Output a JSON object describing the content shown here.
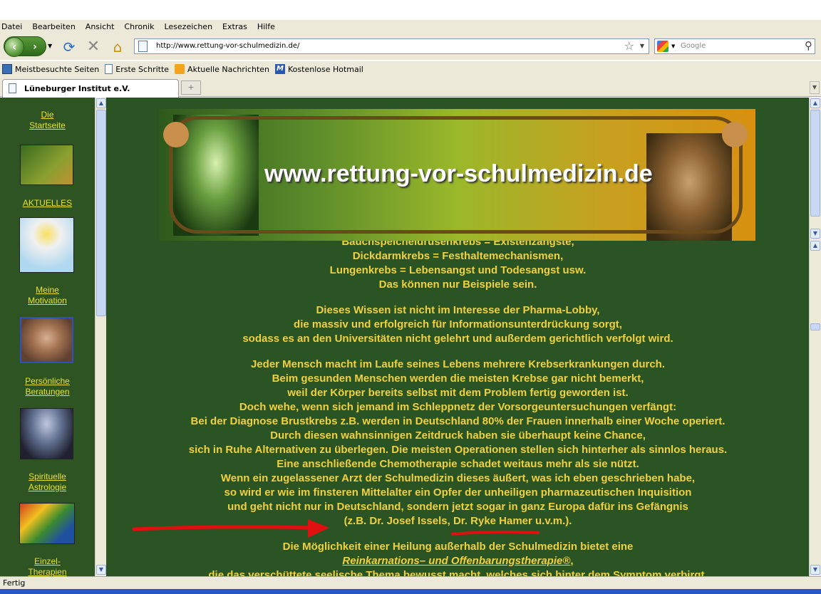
{
  "menu": [
    "Datei",
    "Bearbeiten",
    "Ansicht",
    "Chronik",
    "Lesezeichen",
    "Extras",
    "Hilfe"
  ],
  "url": "http://www.rettung-vor-schulmedizin.de/",
  "search_placeholder": "Google",
  "bookmarks": [
    "Meistbesuchte Seiten",
    "Erste Schritte",
    "Aktuelle Nachrichten",
    "Kostenlose Hotmail"
  ],
  "tab_title": "Lüneburger Institut e.V.",
  "status": "Fertig",
  "sidebar": {
    "startseite": [
      "Die",
      "Startseite"
    ],
    "aktuelles": "AKTUELLES",
    "motivation": [
      "Meine",
      "Motivation"
    ],
    "beratungen": [
      "Persönliche",
      "Beratungen"
    ],
    "astrologie": [
      "Spirituelle",
      "Astrologie"
    ],
    "therapien": [
      "Einzel-",
      "Therapien"
    ]
  },
  "banner_text": "www.rettung-vor-schulmedizin.de",
  "body": {
    "p1": [
      "Bauchspeicheldrüsenkrebs = Existenzängste,",
      "Dickdarmkrebs = Festhaltemechanismen,",
      "Lungenkrebs = Lebensangst und Todesangst usw.",
      "Das können nur Beispiele sein."
    ],
    "p2": [
      "Dieses Wissen ist nicht im Interesse der Pharma-Lobby,",
      "die massiv und erfolgreich für Informationsunterdrückung sorgt,",
      "sodass es an den Universitäten nicht gelehrt und außerdem gerichtlich verfolgt wird."
    ],
    "p3": [
      "Jeder Mensch macht im Laufe seines Lebens mehrere Krebserkrankungen durch.",
      "Beim gesunden Menschen werden die meisten Krebse gar nicht bemerkt,",
      "weil der Körper bereits selbst mit dem Problem fertig geworden ist.",
      "Doch wehe, wenn sich jemand im Schleppnetz der Vorsorgeuntersuchungen verfängt:",
      "Bei der Diagnose Brustkrebs z.B. werden in Deutschland 80% der Frauen innerhalb einer Woche operiert.",
      "Durch diesen wahnsinnigen Zeitdruck haben sie überhaupt keine Chance,",
      "sich in Ruhe Alternativen zu überlegen. Die meisten Operationen stellen sich hinterher als sinnlos heraus.",
      "Eine anschließende Chemotherapie schadet weitaus mehr als sie nützt.",
      "Wenn ein zugelassener Arzt der Schulmedizin dieses äußert, was ich eben geschrieben habe,",
      "so wird er wie im finsteren Mittelalter ein Opfer der unheiligen pharmazeutischen Inquisition",
      "und geht nicht nur in Deutschland, sondern jetzt sogar in ganz Europa dafür ins Gefängnis",
      "(z.B. Dr. Josef Issels, Dr. Ryke Hamer u.v.m.)."
    ],
    "p4_line1": "Die Möglichkeit einer Heilung außerhalb der Schulmedizin bietet eine",
    "p4_link": "Reinkarnations– und Offenbarungstherapie®",
    "p4_after": ",",
    "p4_line3": "die das verschüttete seelische Thema bewusst macht, welches sich hinter dem Symptom verbirgt."
  }
}
